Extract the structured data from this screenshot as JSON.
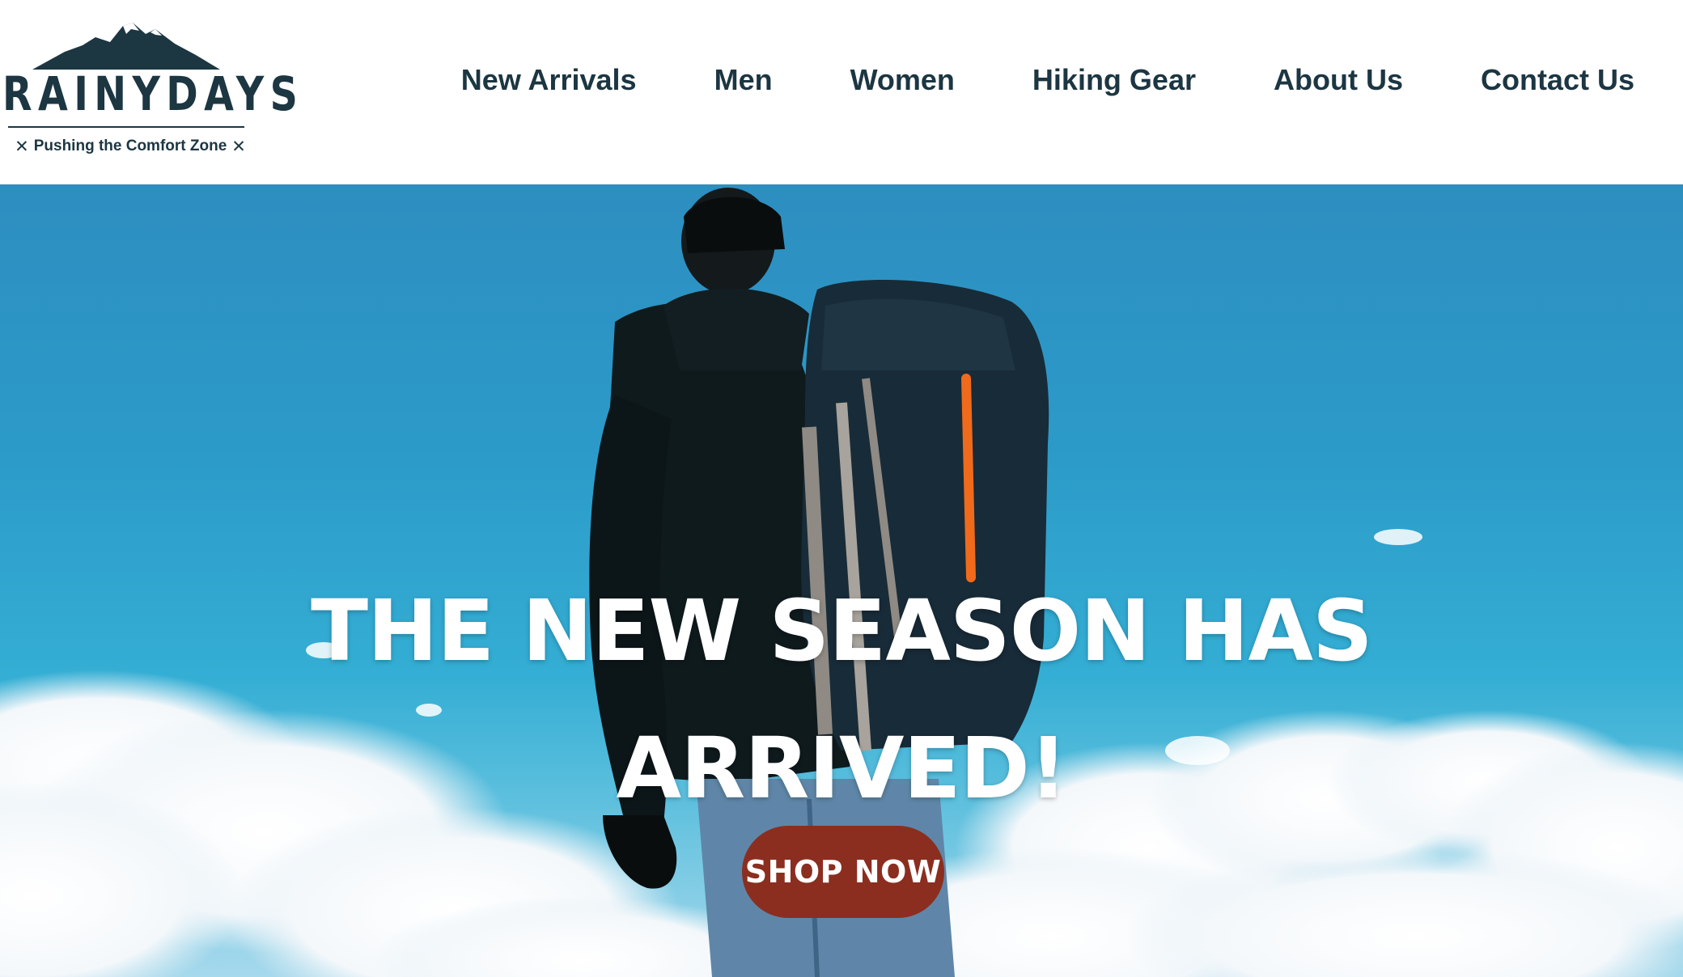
{
  "brand": {
    "name": "RAINYDAYS",
    "tagline": "Pushing the Comfort Zone",
    "color": "#1c3642"
  },
  "nav": {
    "items": [
      {
        "label": "New Arrivals"
      },
      {
        "label": "Men"
      },
      {
        "label": "Women"
      },
      {
        "label": "Hiking Gear"
      },
      {
        "label": "About Us"
      },
      {
        "label": "Contact Us"
      }
    ]
  },
  "hero": {
    "headline_line1": "THE NEW SEASON HAS",
    "headline_line2": "ARRIVED!",
    "cta_label": "SHOP NOW",
    "cta_color": "#8b2e1f",
    "sky_color": "#2c9bc9"
  }
}
